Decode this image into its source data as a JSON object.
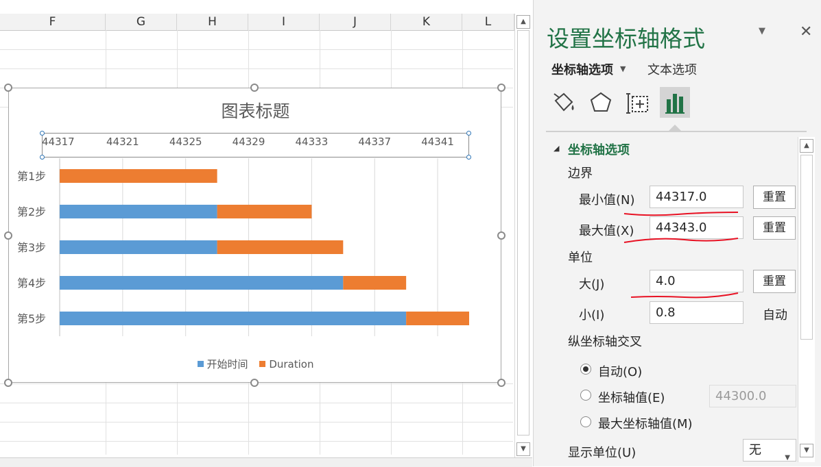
{
  "sheet": {
    "columns": [
      "F",
      "G",
      "H",
      "I",
      "J",
      "K",
      "L"
    ]
  },
  "chart": {
    "title": "图表标题",
    "legend": [
      {
        "label": "开始时间",
        "color": "#5b9bd5"
      },
      {
        "label": "Duration",
        "color": "#ed7d31"
      }
    ]
  },
  "chart_data": {
    "type": "bar",
    "orientation": "horizontal",
    "stacked": true,
    "title": "图表标题",
    "categories": [
      "第1步",
      "第2步",
      "第3步",
      "第4步",
      "第5步"
    ],
    "x_tick_labels": [
      "44317",
      "44321",
      "44325",
      "44329",
      "44333",
      "44337",
      "44341"
    ],
    "xlim": [
      44317,
      44343
    ],
    "x_major_unit": 4,
    "series": [
      {
        "name": "开始时间",
        "color": "#5b9bd5",
        "values": [
          44317,
          44327,
          44327,
          44335,
          44339
        ]
      },
      {
        "name": "Duration",
        "color": "#ed7d31",
        "values": [
          10,
          6,
          8,
          4,
          4
        ]
      }
    ],
    "grid": true,
    "legend_position": "bottom"
  },
  "pane": {
    "title": "设置坐标轴格式",
    "tab_axis": "坐标轴选项",
    "tab_text": "文本选项",
    "section": "坐标轴选项",
    "bounds_label": "边界",
    "min_label": "最小值(N)",
    "min_value": "44317.0",
    "max_label": "最大值(X)",
    "max_value": "44343.0",
    "reset": "重置",
    "units_label": "单位",
    "major_label": "大(J)",
    "major_value": "4.0",
    "minor_label": "小(I)",
    "minor_value": "0.8",
    "auto": "自动",
    "cross_label": "纵坐标轴交叉",
    "radio_auto": "自动(O)",
    "radio_value": "坐标轴值(E)",
    "radio_value_field": "44300.0",
    "radio_max": "最大坐标轴值(M)",
    "display_units_label": "显示单位(U)",
    "display_units_value": "无"
  },
  "icons": [
    "fill-line-icon",
    "effects-icon",
    "size-properties-icon",
    "axis-options-icon",
    "close-icon",
    "chevron-down-icon"
  ]
}
